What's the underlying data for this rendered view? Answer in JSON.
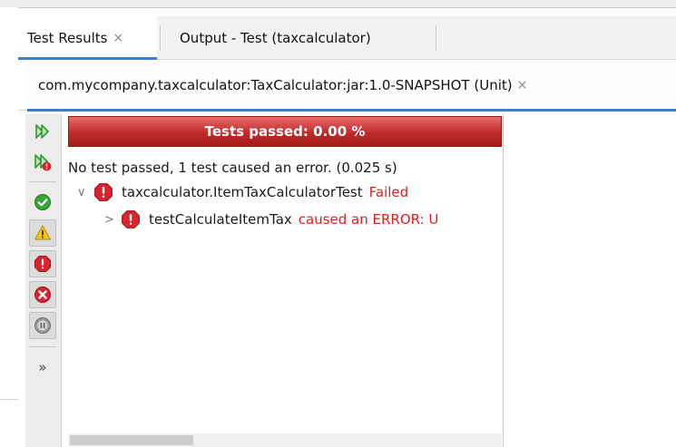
{
  "tabs": [
    {
      "label": "Test Results",
      "close": "×",
      "active": true
    },
    {
      "label": "Output - Test (taxcalculator)",
      "active": false
    }
  ],
  "inner_tab": {
    "label": "com.mycompany.taxcalculator:TaxCalculator:jar:1.0-SNAPSHOT (Unit)",
    "close": "×"
  },
  "toolbar": {
    "buttons": [
      {
        "name": "rerun-icon"
      },
      {
        "name": "rerun-failed-icon"
      },
      {
        "name": "show-passed-icon"
      },
      {
        "name": "show-warnings-icon"
      },
      {
        "name": "show-errors-icon"
      },
      {
        "name": "show-failures-icon"
      },
      {
        "name": "show-skipped-icon"
      }
    ],
    "more": "»"
  },
  "results": {
    "progress_label": "Tests passed: 0.00 %",
    "progress_fraction": 0.0,
    "summary": "No test passed, 1 test caused an error. (0.025 s)",
    "tree": [
      {
        "chevron": "∨",
        "name": "taxcalculator.ItemTaxCalculatorTest",
        "status": "Failed"
      },
      {
        "chevron": ">",
        "name": "testCalculateItemTax",
        "status": "caused an ERROR: U"
      }
    ]
  },
  "colors": {
    "accent": "#3d7fc1",
    "error_red": "#e01e1e",
    "progress_red": "#c02b2b",
    "success_green": "#3ca33c",
    "warning_yellow": "#f5c518"
  }
}
